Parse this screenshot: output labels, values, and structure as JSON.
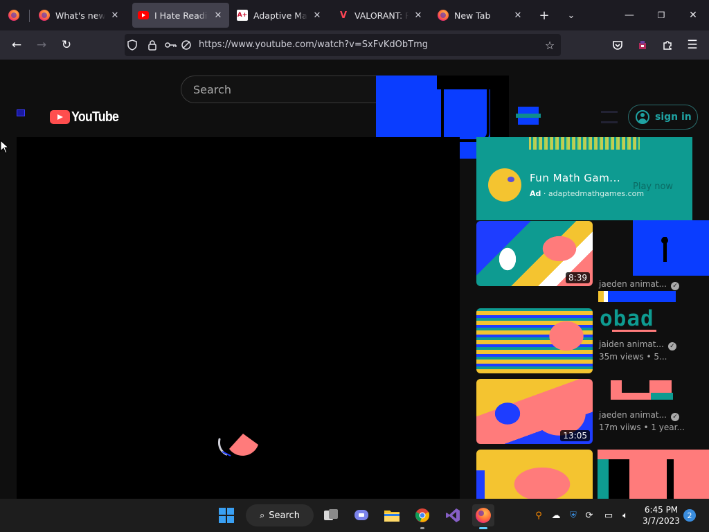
{
  "browser": {
    "tabs": [
      {
        "title": "What's new with",
        "favicon": "firefox-icon",
        "active": false
      },
      {
        "title": "I Hate Reading -",
        "favicon": "youtube-icon",
        "active": true
      },
      {
        "title": "Adaptive Math |",
        "favicon": "aplus-icon",
        "active": false
      },
      {
        "title": "VALORANT: Riot",
        "favicon": "valorant-icon",
        "active": false
      },
      {
        "title": "New Tab",
        "favicon": "firefox-icon",
        "active": false
      }
    ],
    "url": "https://www.youtube.com/watch?v=SxFvKdObTmg",
    "icons": {
      "aplus": "A+",
      "valorant": "V"
    }
  },
  "youtube": {
    "logo_text": "YouTube",
    "search_placeholder": "Search",
    "signin_label": "sign in",
    "ad": {
      "title": "Fun Math Gam...",
      "advertiser_badge": "Ad",
      "advertiser_domain": "· adaptedmathgames.com",
      "cta": "Play now"
    },
    "related": [
      {
        "duration": "8:39",
        "channel": "jaeden animat...",
        "views": "",
        "age": ""
      },
      {
        "duration": "",
        "channel": "jaiden animat...",
        "views": "35m views",
        "age": "• 5..."
      },
      {
        "duration": "13:05",
        "channel": "jaeden animat...",
        "views": "17m viiws",
        "age": "• 1 year..."
      },
      {
        "duration": "",
        "channel": "",
        "views": "",
        "age": ""
      }
    ],
    "glitch_text": "obad"
  },
  "taskbar": {
    "search_label": "Search",
    "time": "6:45 PM",
    "date": "3/7/2023",
    "notification_count": "2"
  },
  "colors": {
    "accent_teal": "#0e9b91",
    "glitch_blue": "#0a3dff",
    "glitch_pink": "#ff7b7b",
    "glitch_yellow": "#f4c430"
  }
}
